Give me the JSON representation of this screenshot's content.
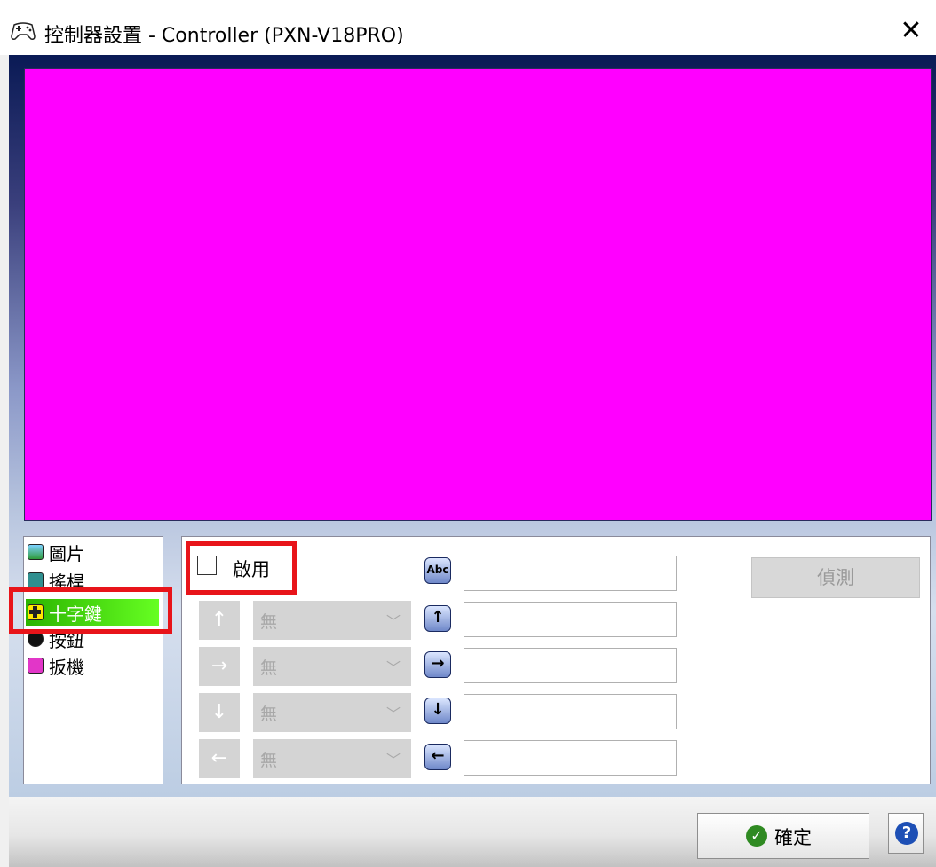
{
  "window": {
    "title": "控制器設置 - Controller (PXN-V18PRO)",
    "close_glyph": "✕",
    "icon": "gamepad-icon"
  },
  "preview": {
    "color": "#ff00ff"
  },
  "nav": {
    "selected_index": 2,
    "items": [
      {
        "label": "圖片",
        "icon": "image-icon",
        "color": "#3fb0ff"
      },
      {
        "label": "搖桿",
        "icon": "joystick-icon",
        "color": "#2f8f8f"
      },
      {
        "label": "十字鍵",
        "icon": "dpad-icon",
        "color": "#ffe600"
      },
      {
        "label": "按鈕",
        "icon": "button-icon",
        "color": "#111111"
      },
      {
        "label": "扳機",
        "icon": "trigger-icon",
        "color": "#e236c8"
      }
    ]
  },
  "dpad": {
    "enable_label": "啟用",
    "enabled": false,
    "name_icon": "Abc",
    "rows": [
      {
        "arrow": "↑",
        "value": "無",
        "icon": "arrow-up-icon"
      },
      {
        "arrow": "→",
        "value": "無",
        "icon": "arrow-right-icon"
      },
      {
        "arrow": "↓",
        "value": "無",
        "icon": "arrow-down-icon"
      },
      {
        "arrow": "←",
        "value": "無",
        "icon": "arrow-left-icon"
      }
    ],
    "dropdown_arrow": "﹀",
    "detect_label": "偵測"
  },
  "footer": {
    "ok_label": "確定",
    "ok_icon_glyph": "✓",
    "help_glyph": "?"
  },
  "highlight_color": "#e8141a"
}
